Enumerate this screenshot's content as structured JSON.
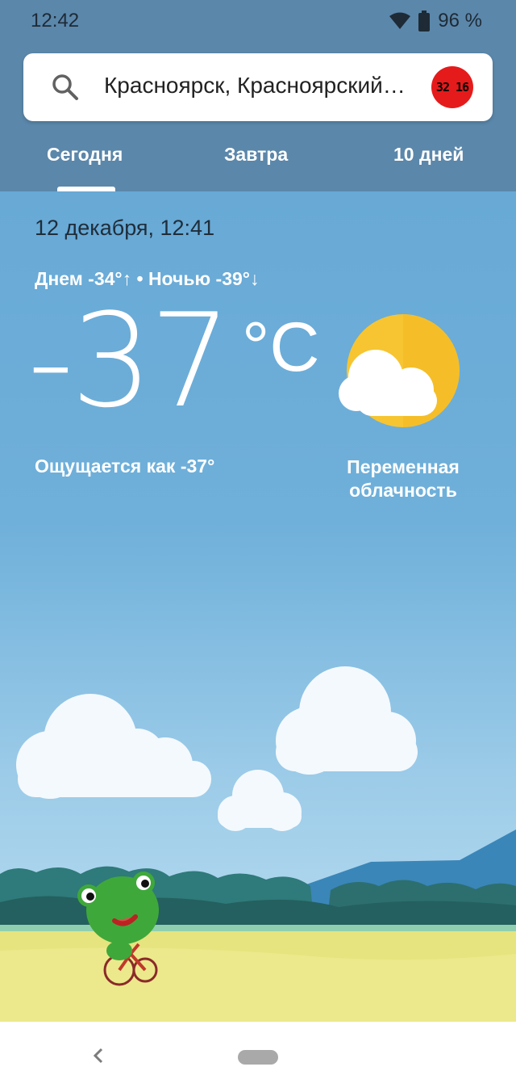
{
  "status_bar": {
    "time": "12:42",
    "battery_text": "96 %"
  },
  "search": {
    "location": "Красноярск, Красноярский…",
    "avatar_text": "32 16"
  },
  "tabs": [
    {
      "label": "Сегодня",
      "selected": true
    },
    {
      "label": "Завтра",
      "selected": false
    },
    {
      "label": "10 дней",
      "selected": false
    }
  ],
  "weather": {
    "date": "12 декабря, 12:41",
    "high_low": "Днем -34°↑ • Ночью -39°↓",
    "temperature": "-37",
    "unit": "°C",
    "feels_like": "Ощущается как -37°",
    "condition_line1": "Переменная",
    "condition_line2": "облачность",
    "condition_icon": "partly-cloudy-icon"
  },
  "colors": {
    "header": "#5b87aa",
    "sky_top": "#68a9d6",
    "sun": "#f7c531",
    "avatar": "#e51b1b"
  }
}
